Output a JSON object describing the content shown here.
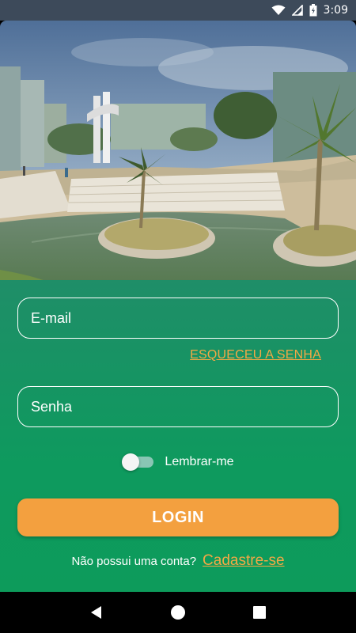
{
  "status_bar": {
    "time": "3:09",
    "icons": [
      "wifi-icon",
      "signal-icon",
      "battery-icon"
    ]
  },
  "hero": {
    "description_icon": "campus-plaza-image"
  },
  "form": {
    "email": {
      "placeholder": "E-mail",
      "value": ""
    },
    "forgot_password": "ESQUECEU A SENHA",
    "password": {
      "placeholder": "Senha",
      "value": ""
    },
    "remember_me": {
      "label": "Lembrar-me",
      "checked": false
    },
    "login_button": "LOGIN",
    "signup_question": "Não possui uma conta?",
    "signup_link": "Cadastre-se"
  },
  "nav_bar": {
    "buttons": [
      "back-icon",
      "home-icon",
      "recents-icon"
    ]
  },
  "colors": {
    "status_bar": "#3d4a5a",
    "form_bg": "#0d9b5b",
    "accent": "#f3a03f",
    "link": "#f3a845"
  }
}
